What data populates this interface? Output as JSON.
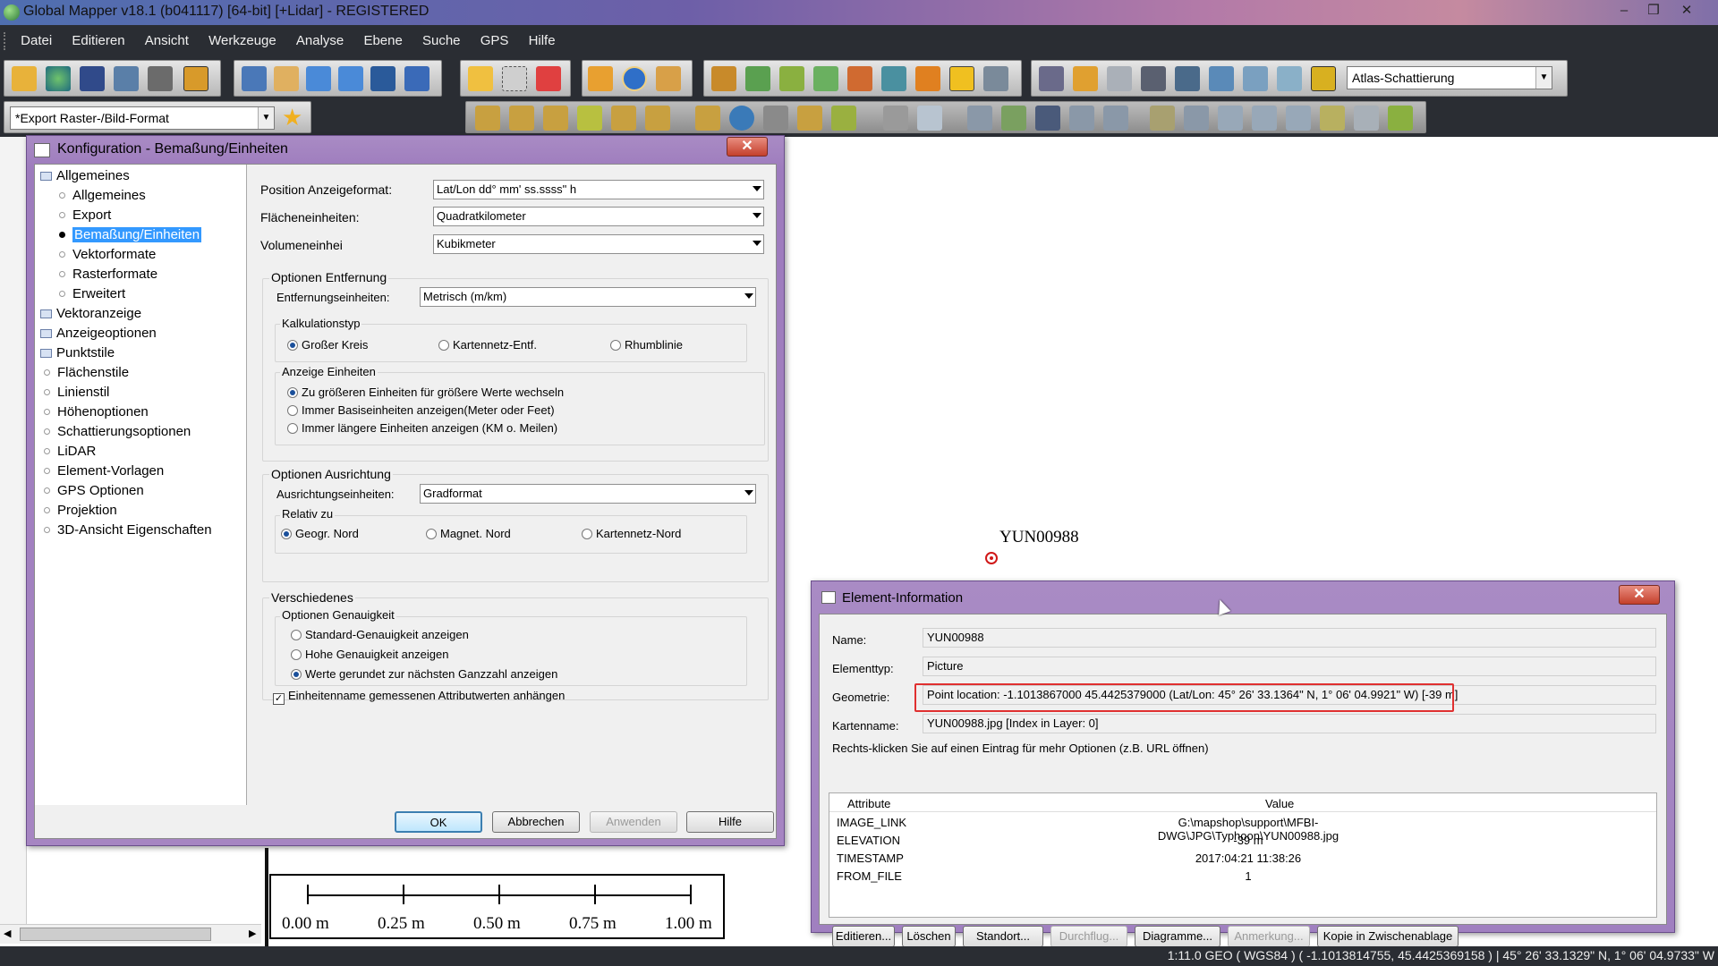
{
  "window": {
    "title": "Global Mapper v18.1 (b041117) [64-bit] [+Lidar] - REGISTERED"
  },
  "menu": [
    "Datei",
    "Editieren",
    "Ansicht",
    "Werkzeuge",
    "Analyse",
    "Ebene",
    "Suche",
    "GPS",
    "Hilfe"
  ],
  "toolbar": {
    "shader_select": "Atlas-Schattierung",
    "export_select": "*Export Raster-/Bild-Format"
  },
  "config_dialog": {
    "title": "Konfiguration - Bemaßung/Einheiten",
    "tree": [
      {
        "label": "Allgemeines",
        "level": 0,
        "type": "folder"
      },
      {
        "label": "Allgemeines",
        "level": 1,
        "type": "page"
      },
      {
        "label": "Export",
        "level": 1,
        "type": "page"
      },
      {
        "label": "Bemaßung/Einheiten",
        "level": 1,
        "type": "page",
        "selected": true
      },
      {
        "label": "Vektorformate",
        "level": 1,
        "type": "page"
      },
      {
        "label": "Rasterformate",
        "level": 1,
        "type": "page"
      },
      {
        "label": "Erweitert",
        "level": 1,
        "type": "page"
      },
      {
        "label": "Vektoranzeige",
        "level": 0,
        "type": "folder"
      },
      {
        "label": "Anzeigeoptionen",
        "level": 0,
        "type": "folder"
      },
      {
        "label": "Punktstile",
        "level": 0,
        "type": "folder"
      },
      {
        "label": "Flächenstile",
        "level": 0,
        "type": "page"
      },
      {
        "label": "Linienstil",
        "level": 0,
        "type": "page"
      },
      {
        "label": "Höhenoptionen",
        "level": 0,
        "type": "page"
      },
      {
        "label": "Schattierungsoptionen",
        "level": 0,
        "type": "page"
      },
      {
        "label": "LiDAR",
        "level": 0,
        "type": "page"
      },
      {
        "label": "Element-Vorlagen",
        "level": 0,
        "type": "page"
      },
      {
        "label": "GPS Optionen",
        "level": 0,
        "type": "page"
      },
      {
        "label": "Projektion",
        "level": 0,
        "type": "page"
      },
      {
        "label": "3D-Ansicht Eigenschaften",
        "level": 0,
        "type": "page"
      }
    ],
    "position_format_label": "Position Anzeigeformat:",
    "position_format_value": "Lat/Lon dd° mm' ss.ssss\" h",
    "area_units_label": "Flächeneinheiten:",
    "area_units_value": "Quadratkilometer",
    "volume_units_label": "Volumeneinhei",
    "volume_units_value": "Kubikmeter",
    "distance_group": "Optionen Entfernung",
    "distance_units_label": "Entfernungseinheiten:",
    "distance_units_value": "Metrisch (m/km)",
    "calc_group": "Kalkulationstyp",
    "calc_options": [
      "Großer Kreis",
      "Kartennetz-Entf.",
      "Rhumblinie"
    ],
    "calc_selected": 0,
    "display_group": "Anzeige Einheiten",
    "display_options": [
      "Zu größeren Einheiten für größere Werte wechseln",
      "Immer Basiseinheiten anzeigen(Meter oder Feet)",
      "Immer längere Einheiten anzeigen (KM o. Meilen)"
    ],
    "display_selected": 0,
    "orient_group": "Optionen Ausrichtung",
    "orient_units_label": "Ausrichtungseinheiten:",
    "orient_units_value": "Gradformat",
    "relative_group": "Relativ zu",
    "relative_options": [
      "Geogr. Nord",
      "Magnet. Nord",
      "Kartennetz-Nord"
    ],
    "relative_selected": 0,
    "misc_group": "Verschiedenes",
    "precision_group": "Optionen Genauigkeit",
    "precision_options": [
      "Standard-Genauigkeit anzeigen",
      "Hohe Genauigkeit anzeigen",
      "Werte gerundet zur nächsten Ganzzahl anzeigen"
    ],
    "precision_selected": 2,
    "append_units_label": "Einheitenname gemessenen Attributwerten anhängen",
    "append_units_checked": true,
    "buttons": {
      "ok": "OK",
      "cancel": "Abbrechen",
      "apply": "Anwenden",
      "help": "Hilfe"
    }
  },
  "map": {
    "point_label": "YUN00988",
    "scale_labels": [
      "0.00 m",
      "0.25 m",
      "0.50 m",
      "0.75 m",
      "1.00 m"
    ]
  },
  "element_info": {
    "title": "Element-Information",
    "name_label": "Name:",
    "name_value": "YUN00988",
    "type_label": "Elementtyp:",
    "type_value": "Picture",
    "geom_label": "Geometrie:",
    "geom_value": "Point location: -1.1013867000 45.4425379000 (Lat/Lon: 45° 26' 33.1364\" N, 1° 06' 04.9921\" W) [-39 m]",
    "mapname_label": "Kartenname:",
    "mapname_value": "YUN00988.jpg [Index in Layer: 0]",
    "hint": "Rechts-klicken Sie auf einen Eintrag für mehr Optionen (z.B. URL öffnen)",
    "attr_header": "Attribute",
    "value_header": "Value",
    "attributes": [
      {
        "k": "IMAGE_LINK",
        "v": "G:\\mapshop\\support\\MFBI-DWG\\JPG\\Typhoon\\YUN00988.jpg"
      },
      {
        "k": "ELEVATION",
        "v": "-39 m"
      },
      {
        "k": "TIMESTAMP",
        "v": "2017:04:21 11:38:26"
      },
      {
        "k": "FROM_FILE",
        "v": "1"
      }
    ],
    "buttons": [
      "Editieren...",
      "Löschen",
      "Standort...",
      "Durchflug...",
      "Diagramme...",
      "Anmerkung...",
      "Kopie in Zwischenablage"
    ],
    "disabled_buttons": [
      3,
      5
    ],
    "highlight_color": "#e03030"
  },
  "statusbar": {
    "text": "1:11.0 GEO ( WGS84 ) ( -1.1013814755, 45.4425369158 ) | 45° 26' 33.1329\" N, 1° 06' 04.9733\" W"
  }
}
